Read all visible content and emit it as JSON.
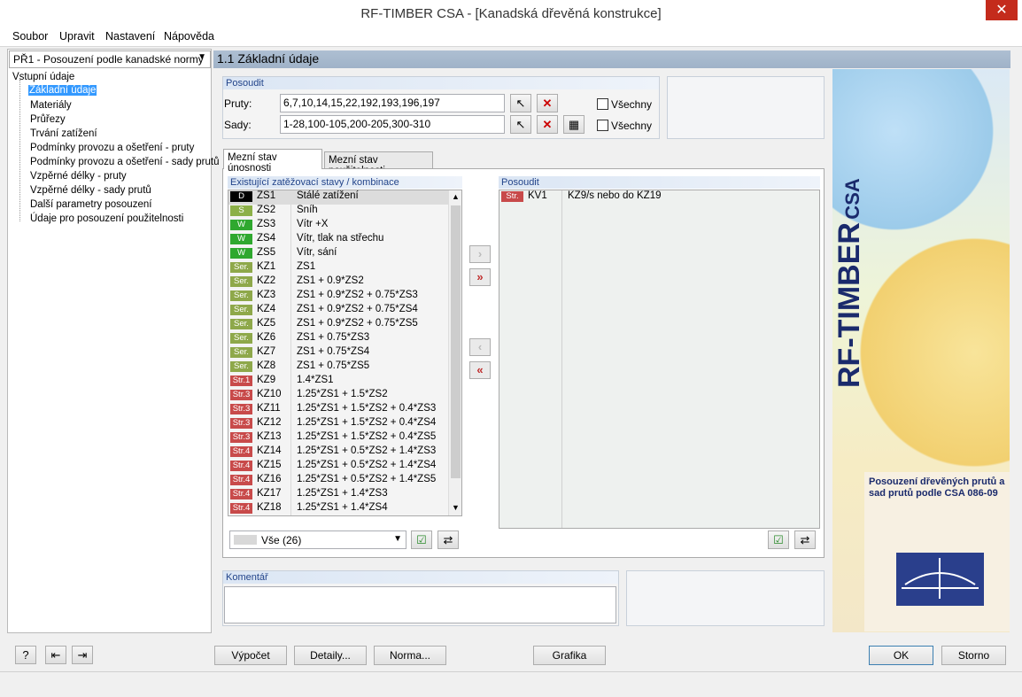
{
  "window": {
    "title": "RF-TIMBER CSA - [Kanadská dřevěná konstrukce]"
  },
  "menu": [
    "Soubor",
    "Upravit",
    "Nastavení",
    "Nápověda"
  ],
  "nav": {
    "case_select": "PŘ1 - Posouzení podle kanadské normy",
    "root": "Vstupní údaje",
    "items": [
      "Základní údaje",
      "Materiály",
      "Průřezy",
      "Trvání zatížení",
      "Podmínky provozu a ošetření - pruty",
      "Podmínky provozu a ošetření - sady prutů",
      "Vzpěrné délky - pruty",
      "Vzpěrné délky - sady prutů",
      "Další parametry posouzení",
      "Údaje pro posouzení použitelnosti"
    ]
  },
  "main": {
    "header": "1.1 Základní údaje",
    "posoudit_group": "Posoudit",
    "pruty_label": "Pruty:",
    "pruty_value": "6,7,10,14,15,22,192,193,196,197",
    "sady_label": "Sady:",
    "sady_value": "1-28,100-105,200-205,300-310",
    "all_label": "Všechny",
    "tabs": [
      "Mezní stav únosnosti",
      "Mezní stav použitelnosti"
    ],
    "existing_header": "Existující zatěžovací stavy / kombinace",
    "selected_header": "Posoudit",
    "existing": [
      {
        "badge": "D",
        "color": "#000000",
        "id": "ZS1",
        "desc": "Stálé zatížení"
      },
      {
        "badge": "S",
        "color": "#8cb048",
        "id": "ZS2",
        "desc": "Sníh"
      },
      {
        "badge": "W",
        "color": "#2fa82f",
        "id": "ZS3",
        "desc": "Vítr +X"
      },
      {
        "badge": "W",
        "color": "#2fa82f",
        "id": "ZS4",
        "desc": "Vítr, tlak na střechu"
      },
      {
        "badge": "W",
        "color": "#2fa82f",
        "id": "ZS5",
        "desc": "Vítr, sání"
      },
      {
        "badge": "Ser.",
        "color": "#8ea84a",
        "id": "KZ1",
        "desc": "ZS1"
      },
      {
        "badge": "Ser.",
        "color": "#8ea84a",
        "id": "KZ2",
        "desc": "ZS1 + 0.9*ZS2"
      },
      {
        "badge": "Ser.",
        "color": "#8ea84a",
        "id": "KZ3",
        "desc": "ZS1 + 0.9*ZS2 + 0.75*ZS3"
      },
      {
        "badge": "Ser.",
        "color": "#8ea84a",
        "id": "KZ4",
        "desc": "ZS1 + 0.9*ZS2 + 0.75*ZS4"
      },
      {
        "badge": "Ser.",
        "color": "#8ea84a",
        "id": "KZ5",
        "desc": "ZS1 + 0.9*ZS2 + 0.75*ZS5"
      },
      {
        "badge": "Ser.",
        "color": "#8ea84a",
        "id": "KZ6",
        "desc": "ZS1 + 0.75*ZS3"
      },
      {
        "badge": "Ser.",
        "color": "#8ea84a",
        "id": "KZ7",
        "desc": "ZS1 + 0.75*ZS4"
      },
      {
        "badge": "Ser.",
        "color": "#8ea84a",
        "id": "KZ8",
        "desc": "ZS1 + 0.75*ZS5"
      },
      {
        "badge": "Str.1",
        "color": "#c84a4a",
        "id": "KZ9",
        "desc": "1.4*ZS1"
      },
      {
        "badge": "Str.3",
        "color": "#c84a4a",
        "id": "KZ10",
        "desc": "1.25*ZS1 + 1.5*ZS2"
      },
      {
        "badge": "Str.3",
        "color": "#c84a4a",
        "id": "KZ11",
        "desc": "1.25*ZS1 + 1.5*ZS2 + 0.4*ZS3"
      },
      {
        "badge": "Str.3",
        "color": "#c84a4a",
        "id": "KZ12",
        "desc": "1.25*ZS1 + 1.5*ZS2 + 0.4*ZS4"
      },
      {
        "badge": "Str.3",
        "color": "#c84a4a",
        "id": "KZ13",
        "desc": "1.25*ZS1 + 1.5*ZS2 + 0.4*ZS5"
      },
      {
        "badge": "Str.4",
        "color": "#c84a4a",
        "id": "KZ14",
        "desc": "1.25*ZS1 + 0.5*ZS2 + 1.4*ZS3"
      },
      {
        "badge": "Str.4",
        "color": "#c84a4a",
        "id": "KZ15",
        "desc": "1.25*ZS1 + 0.5*ZS2 + 1.4*ZS4"
      },
      {
        "badge": "Str.4",
        "color": "#c84a4a",
        "id": "KZ16",
        "desc": "1.25*ZS1 + 0.5*ZS2 + 1.4*ZS5"
      },
      {
        "badge": "Str.4",
        "color": "#c84a4a",
        "id": "KZ17",
        "desc": "1.25*ZS1 + 1.4*ZS3"
      },
      {
        "badge": "Str.4",
        "color": "#c84a4a",
        "id": "KZ18",
        "desc": "1.25*ZS1 + 1.4*ZS4"
      }
    ],
    "selected": [
      {
        "badge": "Str.",
        "color": "#c84a4a",
        "id": "KV1",
        "desc": "KZ9/s nebo do KZ19"
      }
    ],
    "filter_value": "Vše (26)",
    "comment_label": "Komentář"
  },
  "brand": {
    "name": "RF-TIMBER",
    "suffix": "CSA",
    "description": "Posouzení dřevěných prutů a sad prutů podle CSA 086-09"
  },
  "buttons": {
    "calc": "Výpočet",
    "details": "Detaily...",
    "norm": "Norma...",
    "graphics": "Grafika",
    "ok": "OK",
    "cancel": "Storno"
  }
}
